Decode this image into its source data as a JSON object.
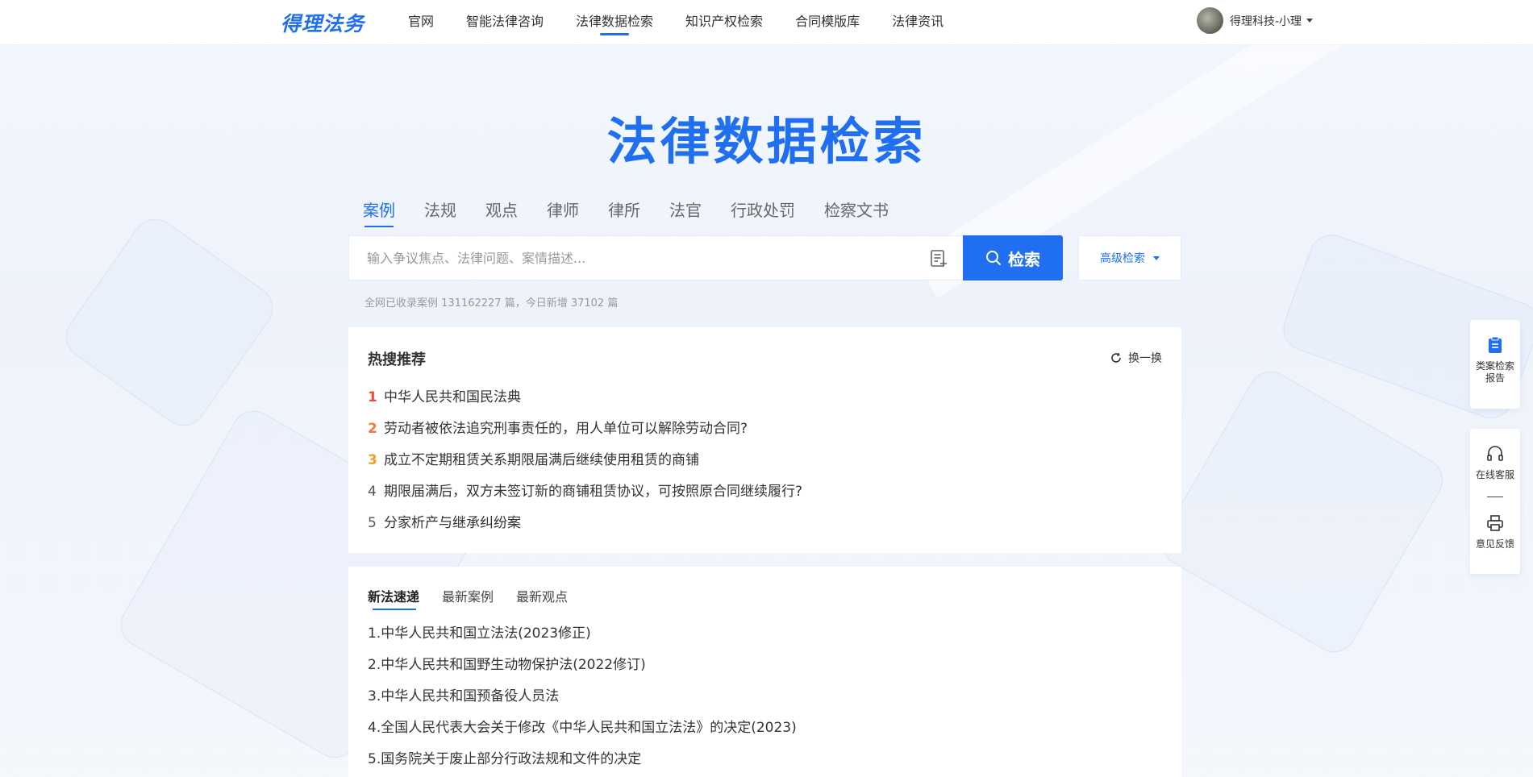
{
  "header": {
    "logo": "得理法务",
    "nav": [
      {
        "label": "官网",
        "active": false
      },
      {
        "label": "智能法律咨询",
        "active": false
      },
      {
        "label": "法律数据检索",
        "active": true
      },
      {
        "label": "知识产权检索",
        "active": false
      },
      {
        "label": "合同模版库",
        "active": false
      },
      {
        "label": "法律资讯",
        "active": false
      }
    ],
    "user_name": "得理科技-小理"
  },
  "hero": {
    "title": "法律数据检索"
  },
  "search": {
    "tabs": [
      {
        "label": "案例",
        "active": true
      },
      {
        "label": "法规",
        "active": false
      },
      {
        "label": "观点",
        "active": false
      },
      {
        "label": "律师",
        "active": false
      },
      {
        "label": "律所",
        "active": false
      },
      {
        "label": "法官",
        "active": false
      },
      {
        "label": "行政处罚",
        "active": false
      },
      {
        "label": "检察文书",
        "active": false
      }
    ],
    "placeholder": "输入争议焦点、法律问题、案情描述...",
    "value": "",
    "button_label": "检索",
    "advanced_label": "高级检索",
    "stats": "全网已收录案例 131162227 篇，今日新增 37102 篇"
  },
  "hot": {
    "title": "热搜推荐",
    "refresh_label": "换一换",
    "items": [
      {
        "rank": "1",
        "text": "中华人民共和国民法典"
      },
      {
        "rank": "2",
        "text": "劳动者被依法追究刑事责任的，用人单位可以解除劳动合同?"
      },
      {
        "rank": "3",
        "text": "成立不定期租赁关系期限届满后继续使用租赁的商铺"
      },
      {
        "rank": "4",
        "text": "期限届满后，双方未签订新的商铺租赁协议，可按照原合同继续履行?"
      },
      {
        "rank": "5",
        "text": "分家析产与继承纠纷案"
      }
    ]
  },
  "news": {
    "tabs": [
      {
        "label": "新法速递",
        "active": true
      },
      {
        "label": "最新案例",
        "active": false
      },
      {
        "label": "最新观点",
        "active": false
      }
    ],
    "items": [
      "1.中华人民共和国立法法(2023修正)",
      "2.中华人民共和国野生动物保护法(2022修订)",
      "3.中华人民共和国预备役人员法",
      "4.全国人民代表大会关于修改《中华人民共和国立法法》的决定(2023)",
      "5.国务院关于废止部分行政法规和文件的决定"
    ]
  },
  "sidebar_tools": {
    "report_label": "类案检索报告",
    "service_label": "在线客服",
    "feedback_label": "意见反馈"
  },
  "colors": {
    "brand": "#1f6ff0",
    "rank1": "#f04b3a",
    "rank2": "#f07a3a",
    "rank3": "#f0a02a"
  }
}
